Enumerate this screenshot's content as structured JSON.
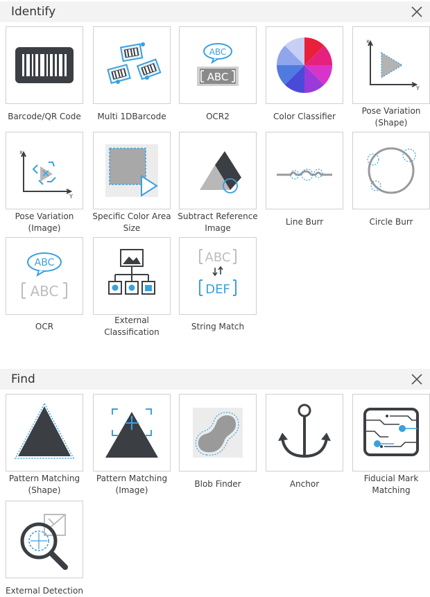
{
  "identify": {
    "title": "Identify",
    "tools": [
      {
        "label1": "Barcode/QR Code",
        "label2": "",
        "icon": "barcode-icon"
      },
      {
        "label1": "Multi 1DBarcode",
        "label2": "",
        "icon": "multi-barcode-icon"
      },
      {
        "label1": "OCR2",
        "label2": "",
        "icon": "ocr2-icon",
        "text_top": "ABC",
        "text_bottom": "ABC"
      },
      {
        "label1": "Color Classifier",
        "label2": "",
        "icon": "color-wheel-icon"
      },
      {
        "label1": "Pose Variation",
        "label2": "(Shape)",
        "icon": "pose-shape-icon",
        "axis_x": "x",
        "axis_y": "Y"
      },
      {
        "label1": "Pose Variation",
        "label2": "(Image)",
        "icon": "pose-image-icon",
        "axis_x": "x",
        "axis_y": "Y"
      },
      {
        "label1": "Specific Color Area",
        "label2": "Size",
        "icon": "color-area-icon"
      },
      {
        "label1": "Subtract Reference",
        "label2": "Image",
        "icon": "subtract-reference-icon"
      },
      {
        "label1": "Line Burr",
        "label2": "",
        "icon": "line-burr-icon"
      },
      {
        "label1": "Circle Burr",
        "label2": "",
        "icon": "circle-burr-icon"
      },
      {
        "label1": "OCR",
        "label2": "",
        "icon": "ocr-icon",
        "text_top": "ABC",
        "text_bottom": "ABC"
      },
      {
        "label1": "External",
        "label2": "Classification",
        "icon": "external-classification-icon"
      },
      {
        "label1": "String Match",
        "label2": "",
        "icon": "string-match-icon",
        "text_top": "ABC",
        "text_bottom": "DEF"
      }
    ]
  },
  "find": {
    "title": "Find",
    "tools": [
      {
        "label1": "Pattern Matching",
        "label2": "(Shape)",
        "icon": "pattern-shape-icon"
      },
      {
        "label1": "Pattern Matching",
        "label2": "(Image)",
        "icon": "pattern-image-icon"
      },
      {
        "label1": "Blob Finder",
        "label2": "",
        "icon": "blob-finder-icon"
      },
      {
        "label1": "Anchor",
        "label2": "",
        "icon": "anchor-icon"
      },
      {
        "label1": "Fiducial Mark",
        "label2": "Matching",
        "icon": "fiducial-mark-icon"
      },
      {
        "label1": "External Detection",
        "label2": "",
        "icon": "external-detection-icon"
      }
    ]
  },
  "colors": {
    "accent_blue": "#3aa0de",
    "dark_icon": "#3b3f44",
    "gray_icon": "#bdbdbd",
    "header_bg": "#f3f3f3",
    "tile_border": "#cfcfcf"
  }
}
